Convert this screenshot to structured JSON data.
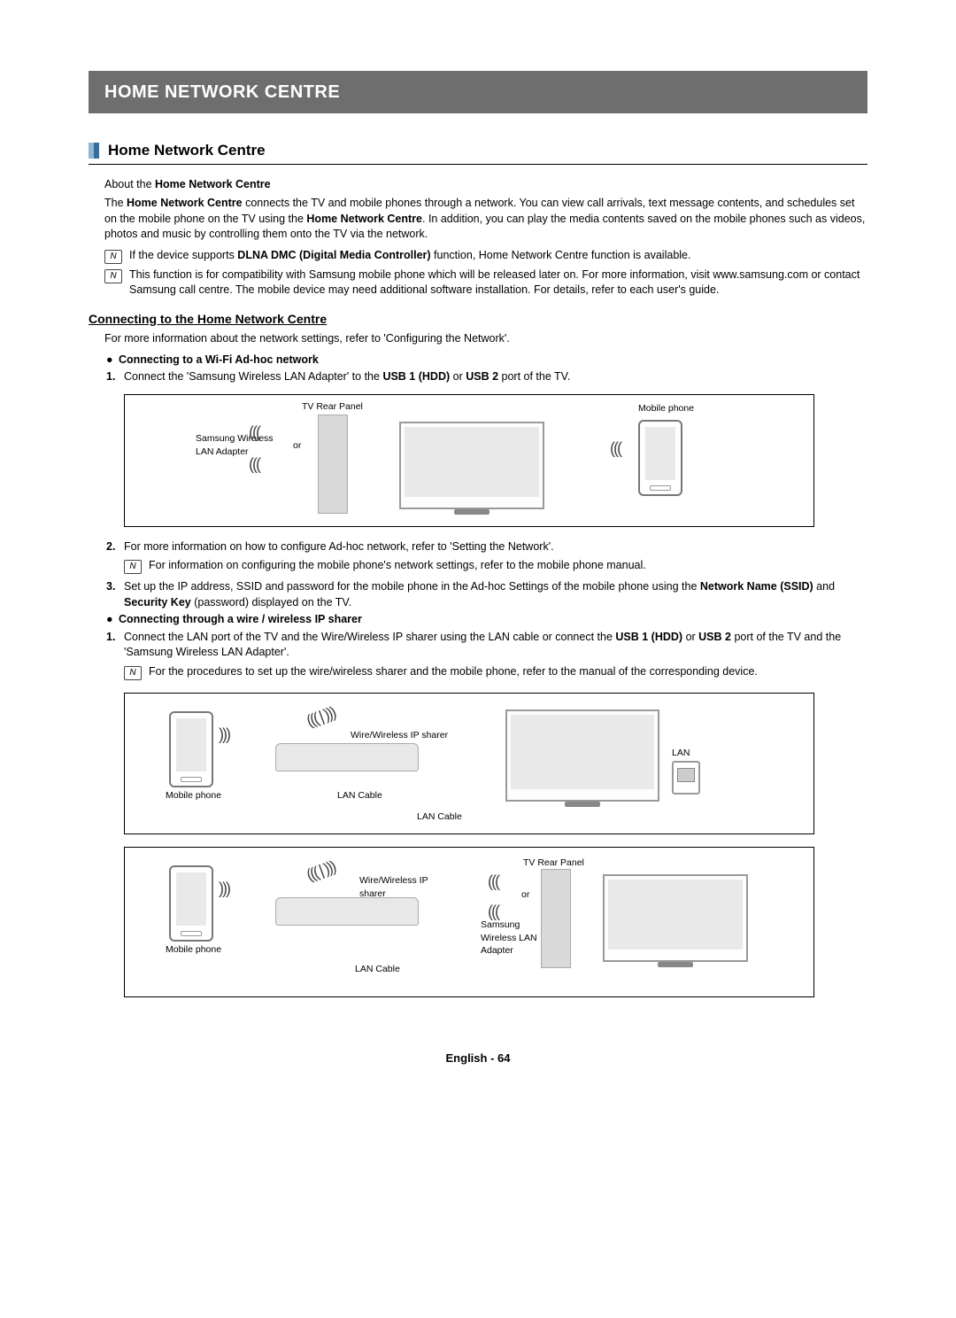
{
  "banner": "HOME NETWORK CENTRE",
  "section_title": "Home Network Centre",
  "about_prefix": "About the ",
  "about_bold": "Home Network Centre",
  "intro_1a": "The ",
  "intro_1b": "Home Network Centre",
  "intro_1c": " connects the TV and mobile phones through a network. You can view call arrivals, text message contents, and schedules set on the mobile phone on the TV using the ",
  "intro_1d": "Home Network Centre",
  "intro_1e": ". In addition, you can play the media contents saved on the mobile phones such as videos, photos and music by controlling them onto the TV via the network.",
  "note1a": "If the device supports ",
  "note1b": "DLNA DMC (Digital Media Controller)",
  "note1c": " function, Home Network Centre function is available.",
  "note2": "This function is for compatibility with Samsung mobile phone which will be released later on. For more information, visit www.samsung.com or contact Samsung call centre. The mobile device may need additional software installation. For details, refer to each user's guide.",
  "subhead": "Connecting to the Home Network Centre",
  "sub_intro": "For more information about the network settings, refer to 'Configuring the Network'.",
  "bullet1": "Connecting to a Wi-Fi Ad-hoc network",
  "step1_num": "1.",
  "step1a": "Connect the 'Samsung Wireless LAN Adapter' to the ",
  "step1b": "USB 1 (HDD)",
  "step1c": " or ",
  "step1d": "USB 2",
  "step1e": " port of the TV.",
  "fig1": {
    "tv_rear": "TV Rear Panel",
    "adapter": "Samsung Wireless LAN Adapter",
    "or": "or",
    "mobile": "Mobile phone"
  },
  "step2_num": "2.",
  "step2": "For more information on how to configure Ad-hoc network, refer to 'Setting the Network'.",
  "step2_note": "For information on configuring the mobile phone's network settings, refer to the mobile phone manual.",
  "step3_num": "3.",
  "step3a": "Set up the IP address, SSID and password for the mobile phone in the Ad-hoc Settings of the mobile phone using the ",
  "step3b": "Network Name (SSID)",
  "step3c": " and ",
  "step3d": "Security Key",
  "step3e": " (password) displayed on the TV.",
  "bullet2": "Connecting through a wire / wireless IP sharer",
  "step4_num": "1.",
  "step4a": "Connect the LAN port of the TV and the Wire/Wireless IP sharer using the LAN cable or connect the ",
  "step4b": "USB 1 (HDD)",
  "step4c": " or ",
  "step4d": "USB 2",
  "step4e": " port of the TV and the 'Samsung Wireless LAN Adapter'.",
  "step4_note": "For the procedures to set up the wire/wireless sharer and the mobile phone, refer to the manual of the corresponding device.",
  "fig2": {
    "sharer": "Wire/Wireless IP sharer",
    "lan": "LAN",
    "lancable": "LAN Cable",
    "mobile": "Mobile phone"
  },
  "fig3": {
    "sharer": "Wire/Wireless IP sharer",
    "rear": "TV Rear Panel",
    "or": "or",
    "adapter": "Samsung Wireless LAN Adapter",
    "lancable": "LAN Cable",
    "mobile": "Mobile phone"
  },
  "footer": "English - 64",
  "note_glyph": "N"
}
